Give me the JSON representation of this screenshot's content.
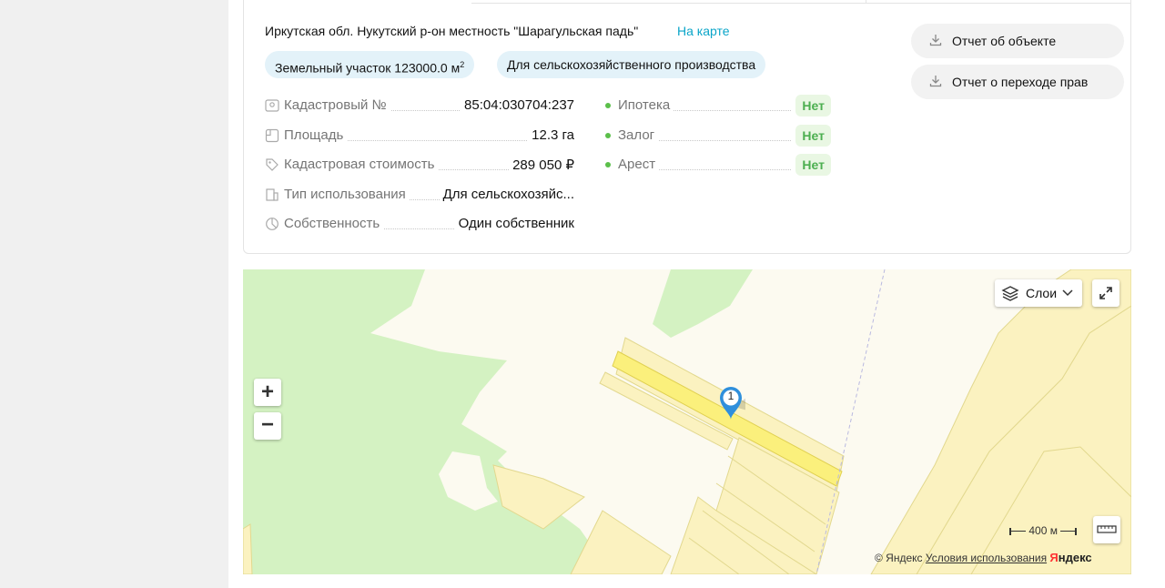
{
  "address": {
    "text": "Иркутская обл. Нукутский р-он местность \"Шарагульская падь\"",
    "map_link": "На карте"
  },
  "chips": [
    {
      "text": "Земельный участок 123000.0 м",
      "sup": "2"
    },
    {
      "text": "Для сельскохозяйственного производства"
    }
  ],
  "properties": [
    {
      "icon": "map-pin-icon",
      "label": "Кадастровый №",
      "value": "85:04:030704:237"
    },
    {
      "icon": "area-icon",
      "label": "Площадь",
      "value": "12.3 га"
    },
    {
      "icon": "price-tag-icon",
      "label": "Кадастровая стоимость",
      "value": "289 050 ₽"
    },
    {
      "icon": "building-icon",
      "label": "Тип использования",
      "value": "Для сельскохозяйс..."
    },
    {
      "icon": "pie-chart-icon",
      "label": "Собственность",
      "value": "Один собственник"
    }
  ],
  "encumbrances": [
    {
      "label": "Ипотека",
      "value": "Нет"
    },
    {
      "label": "Залог",
      "value": "Нет"
    },
    {
      "label": "Арест",
      "value": "Нет"
    }
  ],
  "actions": {
    "object_report": "Отчет об объекте",
    "rights_report": "Отчет о переходе прав"
  },
  "map": {
    "layers_label": "Слои",
    "zoom_in": "+",
    "zoom_out": "−",
    "marker_number": "1",
    "scale": "400 м",
    "copyright": "© Яндекс",
    "terms": "Условия использования",
    "logo_y": "Я",
    "logo_rest": "ндекс",
    "colors": {
      "green": "#d4f2c2",
      "parcel": "#fbf2c0",
      "parcel_border": "#e2d88e",
      "selected": "#fbf07c",
      "marker": "#2f8fdc"
    }
  }
}
